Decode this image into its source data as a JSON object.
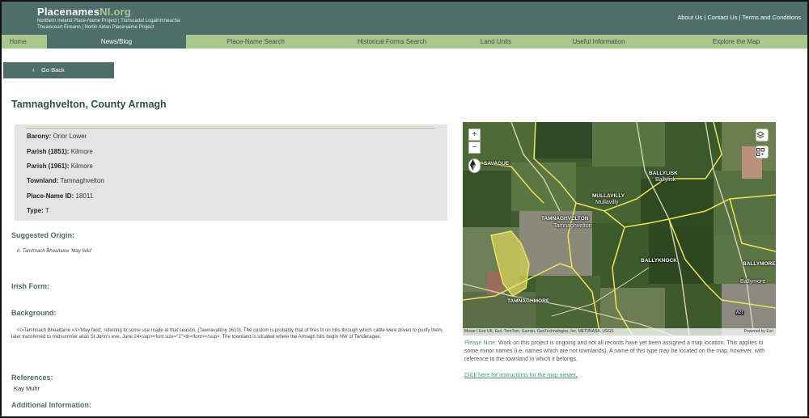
{
  "site": {
    "logo_main": "Placenames",
    "logo_accent": "NI.org",
    "logo_line1": "Northern Ireland Place-Name Project | Tionscadal Logainmneacha",
    "logo_line2": "Thuaisceart Éireann | Norlin Airlan Placenaime Project",
    "top_links": [
      "About Us",
      "Contact Us",
      "Terms and Conditions"
    ],
    "top_sep": " | "
  },
  "nav": {
    "items": [
      "Home",
      "News/Blog",
      "Place-Name Search",
      "Historical Forms Search",
      "Land Units",
      "Useful Information",
      "Explore the Map"
    ],
    "active_index": 1
  },
  "go_back": {
    "chevron": "‹",
    "label": "Go Back"
  },
  "title": "Tamnaghvelton, County Armagh",
  "info": {
    "barony_label": "Barony:",
    "barony": "Orior Lower",
    "parish1851_label": "Parish (1851):",
    "parish1851": "Kilmore",
    "parish1961_label": "Parish (1961):",
    "parish1961": "Kilmore",
    "townland_label": "Townland:",
    "townland": "Tamnaghvelton",
    "pnid_label": "Place-Name ID:",
    "pnid": "18011",
    "type_label": "Type:",
    "type": "T"
  },
  "suggested_origin": {
    "heading": "Suggested Origin:",
    "text": "Ir. Tamhnach Bhealtaine 'May field'"
  },
  "irish_form": {
    "heading": "Irish Form:"
  },
  "background": {
    "heading": "Background:",
    "text": "<i>Tamhnach Bhealtaine </i>'May field', referring to some use made at that season, (Tawnavaltiny 1610).  The custom is probably that of fires lit on hills through which cattle were driven to purify them, later transferred to midsummer alias St John's eve, June 24<sup><font size=\"2\">th</font></sup>. The townland is situated where the Armagh hills begin NW of Tanderagee."
  },
  "references": {
    "heading": "References:",
    "text": "Kay Muhr"
  },
  "additional": {
    "heading": "Additional Information:"
  },
  "map": {
    "zoom_in": "+",
    "zoom_out": "−",
    "labels": {
      "savague": "SAVAGUE",
      "ballylisk": "BALLYLISK",
      "ballylisk_sub": "Ballylisk",
      "mullavilly": "MULLAVILLY",
      "mullavilly_sub": "Mullavilly",
      "tamnaghvelton": "TAMNAGHVELTON",
      "tamnaghvelton_sub": "Tamnaghvelton",
      "ballyknock": "BALLYKNOCK",
      "ballymore": "BALLYMORE",
      "ballymore_sub": "Ballymore",
      "tamnaghmore": "TAMNAGHMORE",
      "road": "A27"
    },
    "attribution": "Maxar | Esri UK, Esri, TomTom, Garmin, GeoTechnologies, Inc, METI/NASA, USGS",
    "powered": "Powered by Esri"
  },
  "note": {
    "label": "Please Note:",
    "text": " Work on this project is ongoing and not all records have yet been assigned a map location. This applies to some minor names (i.e. names which are not townlands). A name of this type may be located on the map, however, with reference to the townland in which it belongs."
  },
  "map_link": "Click here for instructions for the map viewer."
}
